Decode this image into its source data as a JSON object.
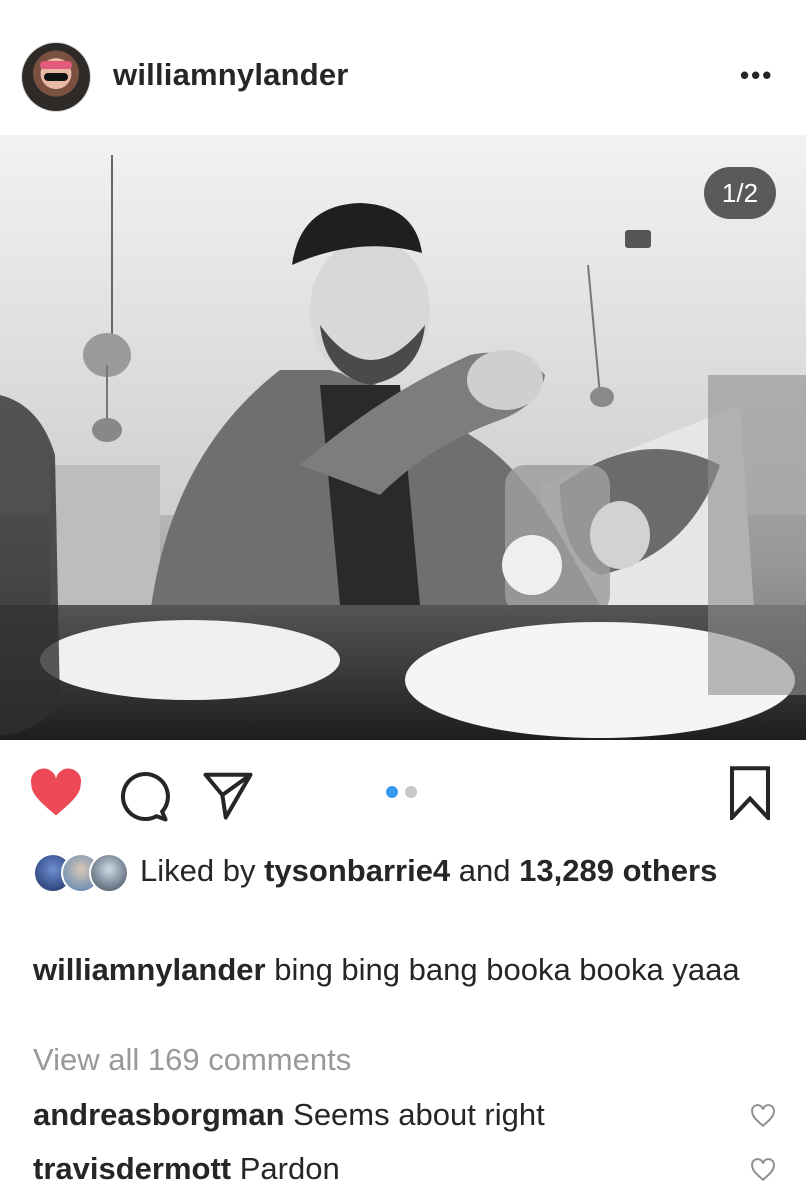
{
  "post": {
    "username": "williamnylander",
    "more_label": "•••",
    "photo_counter": "1/2",
    "photo_alt": "Black and white photo of a smiling man in a cap and denim jacket at a restaurant table with a drink",
    "carousel": {
      "total": 2,
      "active": 1,
      "active_color": "#3897f0",
      "inactive_color": "#c7c7c7"
    },
    "liked": true,
    "like_color": "#ed4956"
  },
  "likes": {
    "prefix": "Liked by",
    "user": "tysonbarrie4",
    "middle": "and",
    "count": "13,289",
    "suffix": "others"
  },
  "caption": {
    "username": "williamnylander",
    "text": "bing bing bang booka booka yaaa"
  },
  "view_all_comments": "View all 169 comments",
  "comments": [
    {
      "username": "andreasborgman",
      "text": "Seems about right"
    },
    {
      "username": "travisdermott",
      "text": "Pardon"
    }
  ],
  "icons": {
    "heart": "heart-icon",
    "comment": "comment-icon",
    "share": "send-icon",
    "save": "bookmark-icon",
    "small_heart": "heart-outline-icon"
  }
}
